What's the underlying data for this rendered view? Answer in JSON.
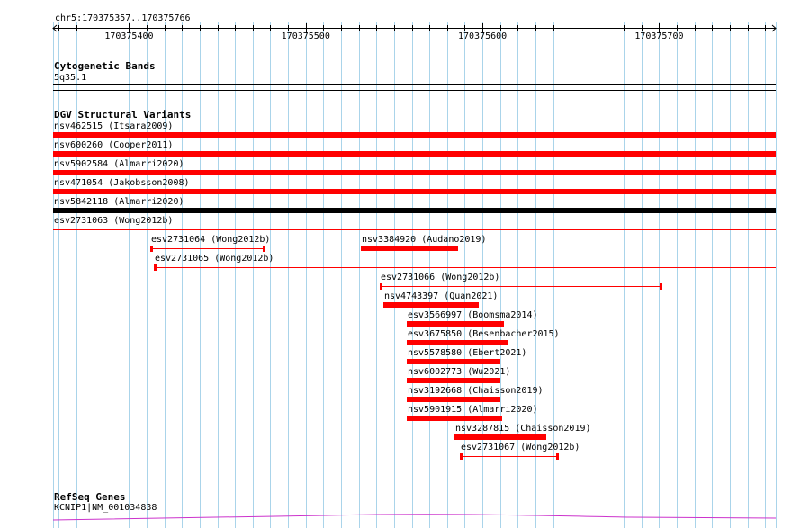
{
  "ruler": {
    "label": "chr5:170375357..170375766",
    "start": 170375357,
    "end": 170375766,
    "ticks": [
      "170375400",
      "170375500",
      "170375600",
      "170375700"
    ]
  },
  "cytoband": {
    "title": "Cytogenetic Bands",
    "band": "5q35.1"
  },
  "dgv": {
    "title": "DGV Structural Variants",
    "features": [
      {
        "label": "nsv462515 (Itsara2009)",
        "start": 170375357,
        "end": 170375766,
        "style": "thick",
        "color": "#ff0000"
      },
      {
        "label": "nsv600260 (Cooper2011)",
        "start": 170375357,
        "end": 170375766,
        "style": "thick",
        "color": "#ff0000"
      },
      {
        "label": "nsv5902584 (Almarri2020)",
        "start": 170375357,
        "end": 170375766,
        "style": "thick",
        "color": "#ff0000"
      },
      {
        "label": "nsv471054 (Jakobsson2008)",
        "start": 170375357,
        "end": 170375766,
        "style": "thick",
        "color": "#ff0000"
      },
      {
        "label": "nsv5842118 (Almarri2020)",
        "start": 170375357,
        "end": 170375766,
        "style": "thick",
        "color": "#000000"
      },
      {
        "label": "esv2731063 (Wong2012b)",
        "start": 170375357,
        "end": 170375766,
        "style": "thin",
        "color": "#ff0000"
      },
      {
        "label": "esv2731064 (Wong2012b)",
        "start": 170375412,
        "end": 170375477,
        "style": "thin-capped",
        "color": "#ff0000"
      },
      {
        "label": "nsv3384920 (Audano2019)",
        "start": 170375531,
        "end": 170375586,
        "style": "thick",
        "color": "#ff0000"
      },
      {
        "label": "esv2731065 (Wong2012b)",
        "start": 170375414,
        "end": 170375766,
        "style": "thin-capped-left",
        "color": "#ff0000"
      },
      {
        "label": "esv2731066 (Wong2012b)",
        "start": 170375542,
        "end": 170375702,
        "style": "thin-capped",
        "color": "#ff0000"
      },
      {
        "label": "nsv4743397 (Quan2021)",
        "start": 170375544,
        "end": 170375598,
        "style": "thick",
        "color": "#ff0000"
      },
      {
        "label": "esv3566997 (Boomsma2014)",
        "start": 170375557,
        "end": 170375612,
        "style": "thick",
        "color": "#ff0000"
      },
      {
        "label": "esv3675850 (Besenbacher2015)",
        "start": 170375557,
        "end": 170375614,
        "style": "thick",
        "color": "#ff0000"
      },
      {
        "label": "nsv5578580 (Ebert2021)",
        "start": 170375557,
        "end": 170375610,
        "style": "thick",
        "color": "#ff0000"
      },
      {
        "label": "nsv6002773 (Wu2021)",
        "start": 170375557,
        "end": 170375610,
        "style": "thick",
        "color": "#ff0000"
      },
      {
        "label": "nsv3192668 (Chaisson2019)",
        "start": 170375557,
        "end": 170375610,
        "style": "thick",
        "color": "#ff0000"
      },
      {
        "label": "nsv5901915 (Almarri2020)",
        "start": 170375557,
        "end": 170375611,
        "style": "thick",
        "color": "#ff0000"
      },
      {
        "label": "nsv3287815 (Chaisson2019)",
        "start": 170375584,
        "end": 170375636,
        "style": "thick",
        "color": "#ff0000"
      },
      {
        "label": "esv2731067 (Wong2012b)",
        "start": 170375587,
        "end": 170375643,
        "style": "thin-capped",
        "color": "#ff0000"
      }
    ]
  },
  "refseq": {
    "title": "RefSeq Genes",
    "gene": "KCNIP1|NM_001034838",
    "color": "#cc33cc"
  },
  "colors": {
    "grid": "#aad4ea",
    "ruler": "#000000"
  }
}
